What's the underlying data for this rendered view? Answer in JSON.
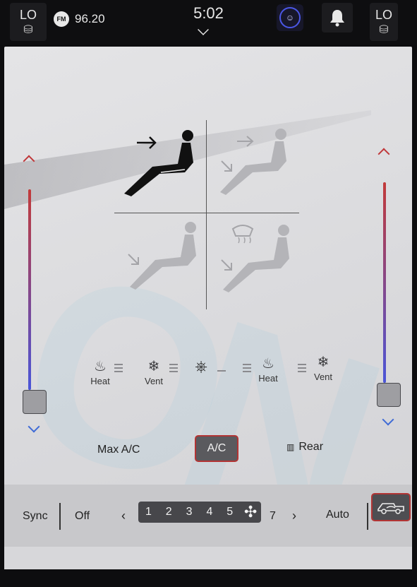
{
  "topbar": {
    "left_temp": "LO",
    "right_temp": "LO",
    "radio_band": "FM",
    "radio_freq": "96.20",
    "clock": "5:02"
  },
  "seats": {
    "driver_heat": "Heat",
    "driver_vent": "Vent",
    "passenger_heat": "Heat",
    "passenger_vent": "Vent"
  },
  "buttons": {
    "max_ac": "Max A/C",
    "ac": "A/C",
    "rear": "Rear"
  },
  "fan": {
    "sync": "Sync",
    "off": "Off",
    "speeds": [
      "1",
      "2",
      "3",
      "4",
      "5"
    ],
    "max_speed": "7",
    "auto": "Auto",
    "prev": "‹",
    "next": "›"
  },
  "colors": {
    "accent_red": "#b23434",
    "accent_blue": "#4b57e6",
    "hot": "#c23a3a",
    "cold": "#4a55d8"
  },
  "icons": [
    "seat-heat-icon",
    "seat-vent-icon",
    "steering-wheel-heat-icon",
    "fan-icon",
    "defrost-icon",
    "truck-recirc-icon",
    "bell-icon",
    "driver-profile-icon"
  ]
}
